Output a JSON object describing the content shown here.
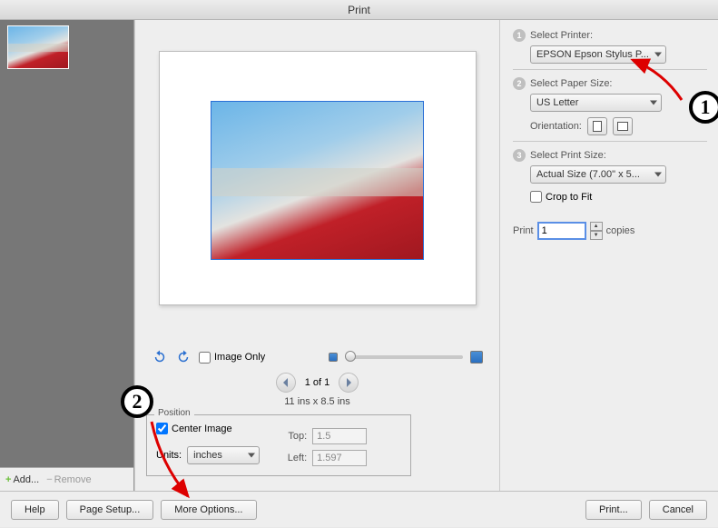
{
  "window": {
    "title": "Print"
  },
  "sidebar": {
    "add_label": "Add...",
    "remove_label": "Remove"
  },
  "preview": {
    "image_only_label": "Image Only",
    "image_only_checked": false,
    "pager_text": "1 of 1",
    "dimensions_text": "11 ins x 8.5 ins"
  },
  "position": {
    "group_label": "Position",
    "center_image_label": "Center Image",
    "center_image_checked": true,
    "units_label": "Units:",
    "units_value": "inches",
    "top_label": "Top:",
    "top_value": "1.5",
    "left_label": "Left:",
    "left_value": "1.597"
  },
  "printer": {
    "section1_label": "Select Printer:",
    "printer_value": "EPSON Epson Stylus P...",
    "section2_label": "Select Paper Size:",
    "paper_value": "US Letter",
    "orientation_label": "Orientation:",
    "section3_label": "Select Print Size:",
    "print_size_value": "Actual Size (7.00\" x 5...",
    "crop_label": "Crop to Fit",
    "crop_checked": false,
    "copies_prefix": "Print",
    "copies_value": "1",
    "copies_suffix": "copies"
  },
  "buttons": {
    "help": "Help",
    "page_setup": "Page Setup...",
    "more_options": "More Options...",
    "print": "Print...",
    "cancel": "Cancel"
  },
  "annotations": {
    "callout1": "1",
    "callout2": "2"
  }
}
